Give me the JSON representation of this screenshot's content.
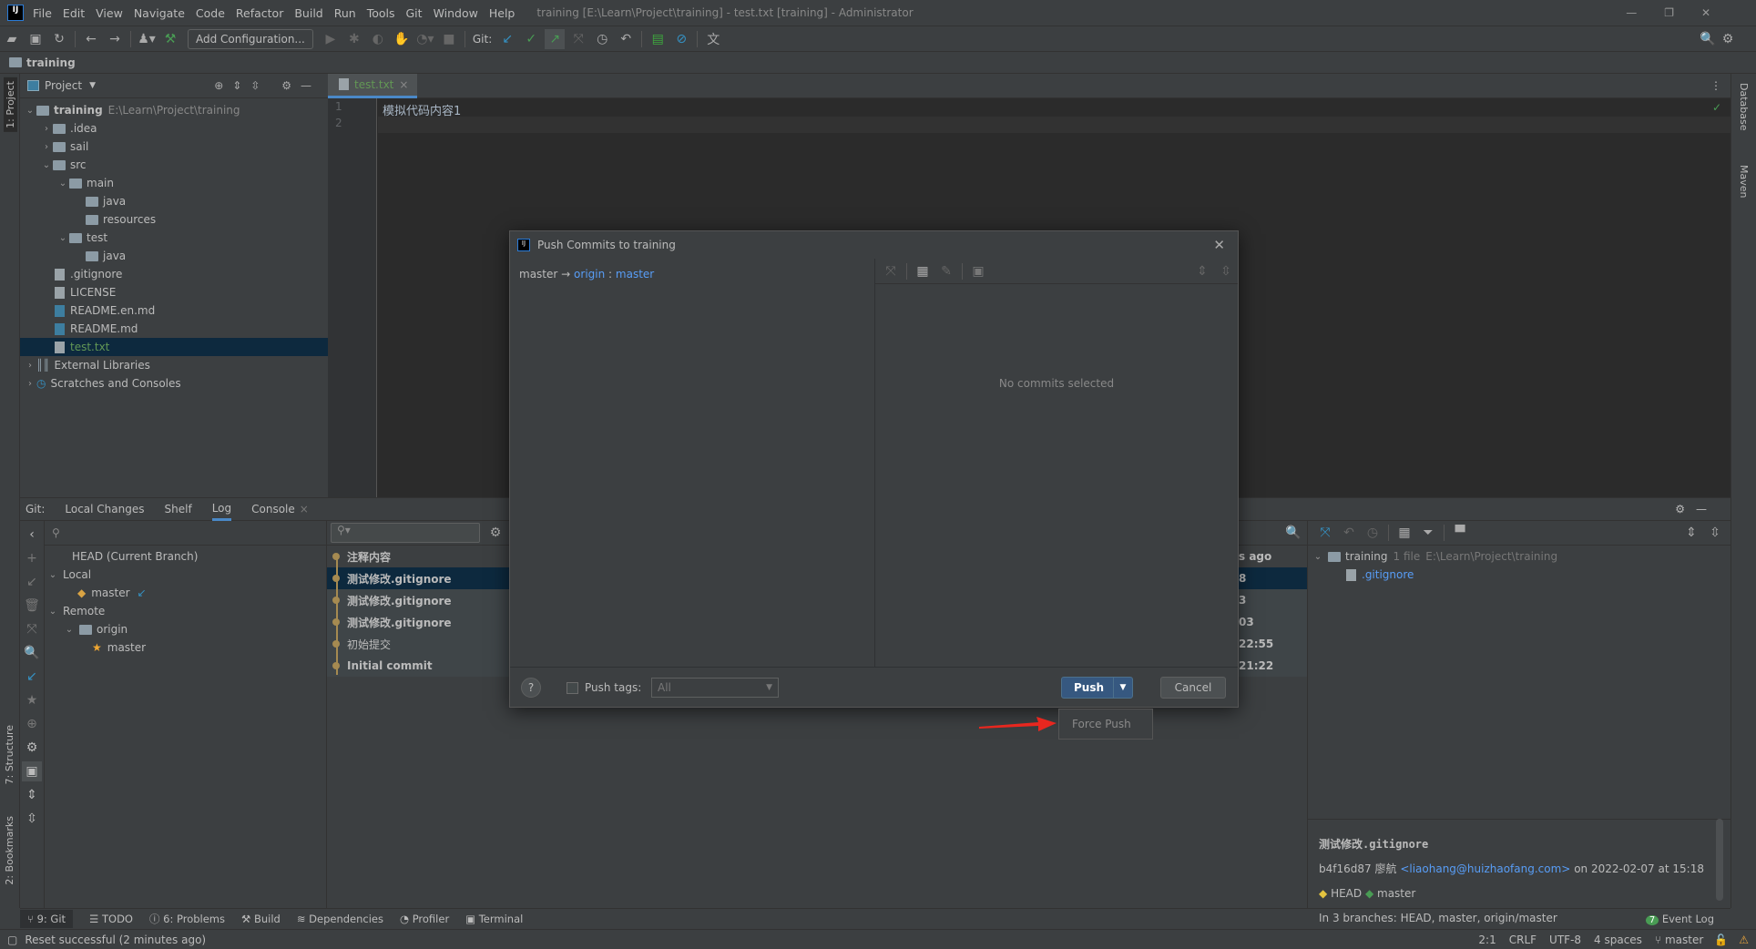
{
  "menubar": {
    "items": [
      "File",
      "Edit",
      "View",
      "Navigate",
      "Code",
      "Refactor",
      "Build",
      "Run",
      "Tools",
      "Git",
      "Window",
      "Help"
    ],
    "title": "training [E:\\Learn\\Project\\training] - test.txt [training] - Administrator"
  },
  "toolbar": {
    "add_configuration": "Add Configuration...",
    "git_label": "Git:"
  },
  "navbar": {
    "project": "training"
  },
  "left_stripe": {
    "project": "1: Project",
    "structure": "7: Structure",
    "bookmarks": "2: Bookmarks"
  },
  "right_stripe": {
    "database": "Database",
    "maven": "Maven"
  },
  "project_panel": {
    "title": "Project",
    "root": "training",
    "root_path": "E:\\Learn\\Project\\training",
    "items": [
      {
        "label": ".idea",
        "depth": 1,
        "type": "folder",
        "chev": ">"
      },
      {
        "label": "sail",
        "depth": 1,
        "type": "folder",
        "chev": ">"
      },
      {
        "label": "src",
        "depth": 1,
        "type": "folder",
        "chev": "v"
      },
      {
        "label": "main",
        "depth": 2,
        "type": "folder",
        "chev": "v"
      },
      {
        "label": "java",
        "depth": 3,
        "type": "folder",
        "chev": ""
      },
      {
        "label": "resources",
        "depth": 3,
        "type": "folder",
        "chev": ""
      },
      {
        "label": "test",
        "depth": 2,
        "type": "folder",
        "chev": "v"
      },
      {
        "label": "java",
        "depth": 3,
        "type": "folder",
        "chev": ""
      },
      {
        "label": ".gitignore",
        "depth": 1,
        "type": "file",
        "chev": ""
      },
      {
        "label": "LICENSE",
        "depth": 1,
        "type": "file",
        "chev": ""
      },
      {
        "label": "README.en.md",
        "depth": 1,
        "type": "md",
        "chev": ""
      },
      {
        "label": "README.md",
        "depth": 1,
        "type": "md",
        "chev": ""
      },
      {
        "label": "test.txt",
        "depth": 1,
        "type": "file",
        "chev": "",
        "selected": true
      }
    ],
    "external": "External Libraries",
    "scratches": "Scratches and Consoles"
  },
  "editor": {
    "tab": "test.txt",
    "lines": [
      "1",
      "2"
    ],
    "code": "模拟代码内容1"
  },
  "bottom": {
    "tabs": [
      "Git:",
      "Local Changes",
      "Shelf",
      "Log",
      "Console"
    ],
    "active_tab": "Log",
    "branches": {
      "head": "HEAD (Current Branch)",
      "local": "Local",
      "local_master": "master",
      "remote": "Remote",
      "origin": "origin",
      "remote_master": "master"
    },
    "log": {
      "rows": [
        {
          "msg": "注释内容",
          "time": "s ago"
        },
        {
          "msg": "测试修改.gitignore",
          "time": "8",
          "selected": true
        },
        {
          "msg": "测试修改.gitignore",
          "time": "3"
        },
        {
          "msg": "测试修改.gitignore",
          "time": "03"
        },
        {
          "msg": "初始提交",
          "time": "22:55"
        },
        {
          "msg": "Initial commit",
          "time": "21:22"
        }
      ]
    },
    "changes": {
      "root": "training",
      "count": "1 file",
      "path": "E:\\Learn\\Project\\training",
      "file": ".gitignore"
    },
    "details": {
      "subject": "测试修改.gitignore",
      "hash": "b4f16d87",
      "author": "廖航",
      "email": "<liaohang@huizhaofang.com>",
      "date": "on 2022-02-07 at 15:18",
      "tag_head": "HEAD",
      "tag_master": "master",
      "branches": "In 3 branches: HEAD, master, origin/master"
    }
  },
  "toolwindows": [
    "9: Git",
    "TODO",
    "6: Problems",
    "Build",
    "Dependencies",
    "Profiler",
    "Terminal"
  ],
  "event_log": {
    "count": "7",
    "label": "Event Log"
  },
  "status": {
    "message": "Reset successful (2 minutes ago)",
    "position": "2:1",
    "line_sep": "CRLF",
    "encoding": "UTF-8",
    "indent": "4 spaces",
    "branch": "master"
  },
  "dialog": {
    "title": "Push Commits to training",
    "src": "master",
    "arrow": "→",
    "remote": "origin",
    "sep": ":",
    "dest": "master",
    "empty": "No commits selected",
    "help": "?",
    "push_tags": "Push tags:",
    "tags_value": "All",
    "push": "Push",
    "cancel": "Cancel",
    "force_push": "Force Push"
  },
  "colors": {
    "accent": "#4a88c7",
    "selection": "#0d293e",
    "link": "#589df6",
    "annotation_arrow": "#e8271f"
  }
}
